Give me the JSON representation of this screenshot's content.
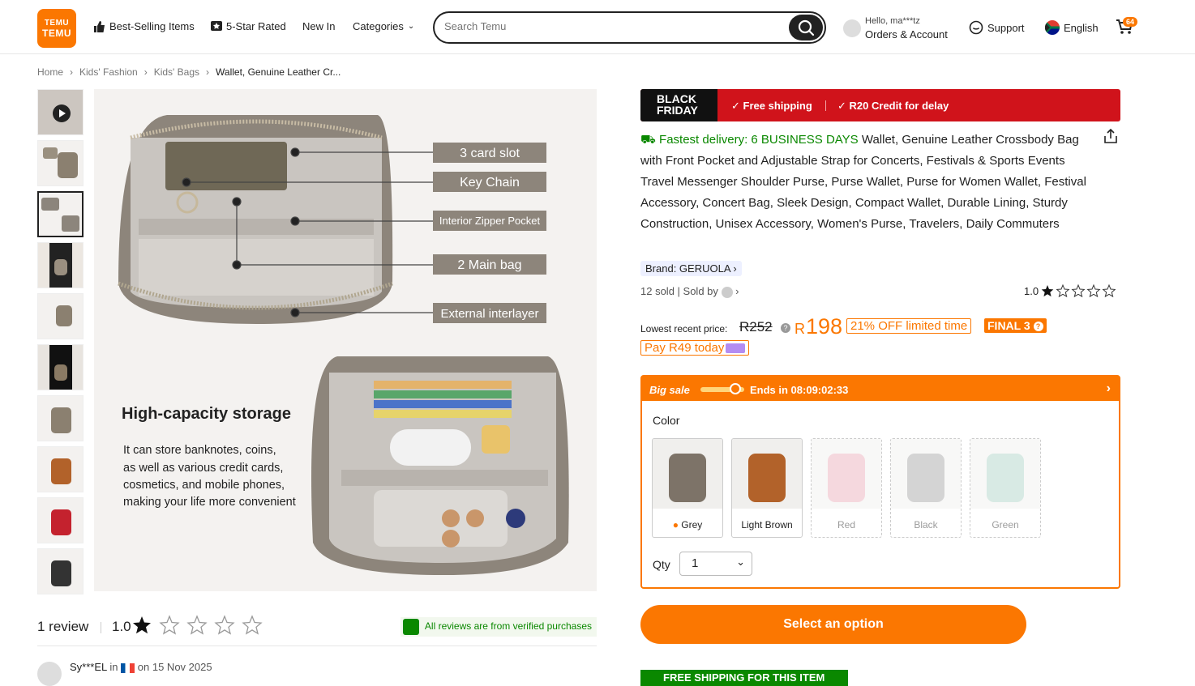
{
  "header": {
    "logo_line1": "TEMU",
    "logo_line2": "TEMU",
    "nav": [
      "Best-Selling Items",
      "5-Star Rated",
      "New In",
      "Categories"
    ],
    "search_placeholder": "Search Temu",
    "account_hello": "Hello, ma***tz",
    "account_label": "Orders & Account",
    "support": "Support",
    "language": "English",
    "cart_count": "64"
  },
  "breadcrumb": [
    "Home",
    "Kids' Fashion",
    "Kids' Bags",
    "Wallet, Genuine Leather Cr..."
  ],
  "gallery": {
    "thumbnails": [
      "video",
      "info",
      "selected",
      "model",
      "info",
      "model",
      "grey",
      "brown",
      "red",
      "black"
    ],
    "image_text": {
      "label_1": "3 card slot",
      "label_2": "Key Chain",
      "label_3": "Interior Zipper Pocket",
      "label_4": "2 Main bag",
      "label_5": "External interlayer",
      "heading": "High-capacity storage",
      "body_1": "It can store banknotes, coins,",
      "body_2": "as well as various credit cards,",
      "body_3": "cosmetics, and mobile phones,",
      "body_4": "making your life more convenient"
    }
  },
  "reviews": {
    "title": "1 review",
    "score": "1.0",
    "verified": "All reviews are from verified purchases",
    "user": "Sy***EL",
    "user_in": "in",
    "user_date": "on 15 Nov 2025"
  },
  "product": {
    "banner_logo_1": "BLACK",
    "banner_logo_2": "FRIDAY",
    "banner_1": "Free shipping",
    "banner_2": "R20 Credit for delay",
    "fast_delivery": "Fastest delivery: 6 BUSINESS DAYS",
    "title": "Wallet, Genuine Leather Crossbody Bag with Front Pocket and Adjustable Strap for Concerts, Festivals & Sports Events Travel Messenger Shoulder Purse, Purse Wallet, Purse for Women Wallet, Festival Accessory, Concert Bag, Sleek Design, Compact Wallet, Durable Lining, Sturdy Construction, Unisex Accessory, Women's Purse, Travelers, Daily Commuters",
    "brand": "Brand: GERUOLA",
    "sold": "12 sold",
    "sold_by": "Sold by",
    "rating": "1.0",
    "lowest_price_label": "Lowest recent price:",
    "old_price": "R252",
    "currency": "R",
    "price": "198",
    "off": "21% OFF limited time",
    "final": "FINAL 3",
    "pay_today": "Pay R49 today"
  },
  "sale": {
    "label": "Big sale",
    "ends": "Ends in 08:09:02:33",
    "color_label": "Color",
    "colors": [
      {
        "name": "Grey",
        "hex": "#7d7368",
        "available": true
      },
      {
        "name": "Light Brown",
        "hex": "#b2622a",
        "available": true
      },
      {
        "name": "Red",
        "hex": "#e9a9b6",
        "available": false
      },
      {
        "name": "Black",
        "hex": "#a0a0a0",
        "available": false
      },
      {
        "name": "Green",
        "hex": "#a9d0c4",
        "available": false
      }
    ],
    "qty_label": "Qty",
    "qty_value": "1"
  },
  "cta": {
    "select_option": "Select an option",
    "free_shipping": "FREE SHIPPING FOR THIS ITEM"
  },
  "colors": {
    "accent": "#fb7701",
    "green": "#0a8800",
    "banner_red": "#d0131b"
  }
}
